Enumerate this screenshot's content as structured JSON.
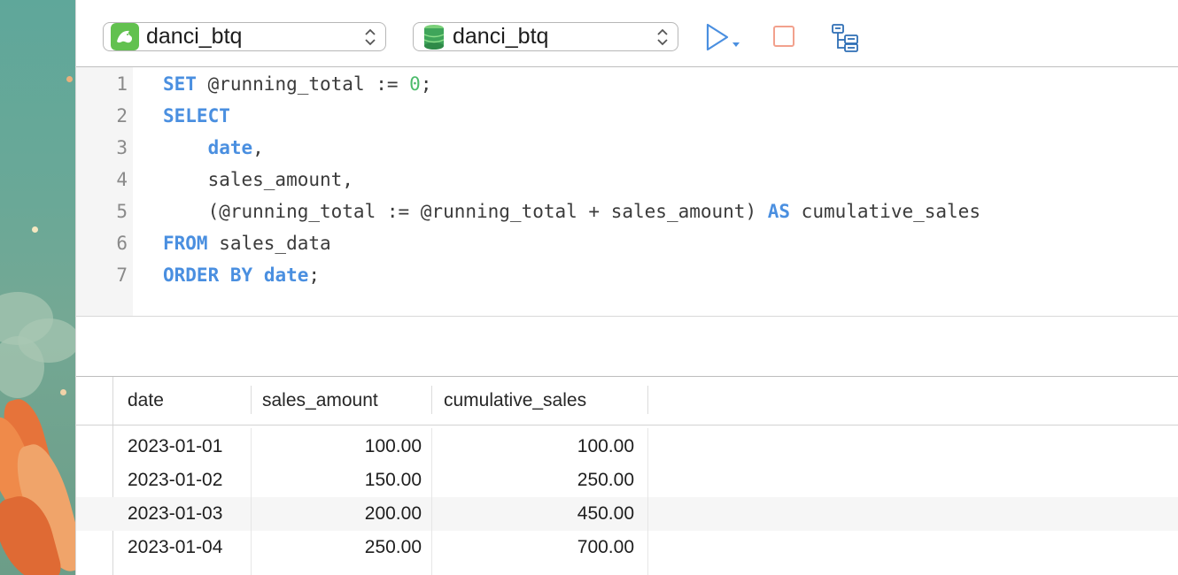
{
  "toolbar": {
    "connection": {
      "label": "danci_btq",
      "icon": "mysql-dolphin-icon"
    },
    "database": {
      "label": "danci_btq",
      "icon": "database-stack-icon"
    },
    "run": {
      "icon": "play-icon"
    },
    "stop": {
      "icon": "stop-icon"
    },
    "explain": {
      "icon": "explain-tree-icon"
    }
  },
  "colors": {
    "keyword": "#4a8fe0",
    "number": "#4cbb6b",
    "run": "#4a8fe0",
    "stop": "#f2a18d",
    "mysql": "#62c14f"
  },
  "editor": {
    "lines": [
      {
        "num": "1",
        "segments": [
          {
            "t": "SET",
            "k": "kw"
          },
          {
            "t": " @running_total := "
          },
          {
            "t": "0",
            "k": "num"
          },
          {
            "t": ";"
          }
        ]
      },
      {
        "num": "2",
        "segments": [
          {
            "t": "SELECT",
            "k": "kw"
          }
        ]
      },
      {
        "num": "3",
        "segments": [
          {
            "t": "    "
          },
          {
            "t": "date",
            "k": "kw"
          },
          {
            "t": ","
          }
        ]
      },
      {
        "num": "4",
        "segments": [
          {
            "t": "    sales_amount,"
          }
        ]
      },
      {
        "num": "5",
        "segments": [
          {
            "t": "    (@running_total := @running_total + sales_amount) "
          },
          {
            "t": "AS",
            "k": "kw"
          },
          {
            "t": " cumulative_sales"
          }
        ]
      },
      {
        "num": "6",
        "segments": [
          {
            "t": "FROM",
            "k": "kw"
          },
          {
            "t": " sales_data"
          }
        ]
      },
      {
        "num": "7",
        "segments": [
          {
            "t": "ORDER BY",
            "k": "kw"
          },
          {
            "t": " "
          },
          {
            "t": "date",
            "k": "kw"
          },
          {
            "t": ";"
          }
        ]
      }
    ]
  },
  "results": {
    "columns": [
      "date",
      "sales_amount",
      "cumulative_sales"
    ],
    "rows": [
      [
        "2023-01-01",
        "100.00",
        "100.00"
      ],
      [
        "2023-01-02",
        "150.00",
        "250.00"
      ],
      [
        "2023-01-03",
        "200.00",
        "450.00"
      ],
      [
        "2023-01-04",
        "250.00",
        "700.00"
      ]
    ]
  }
}
